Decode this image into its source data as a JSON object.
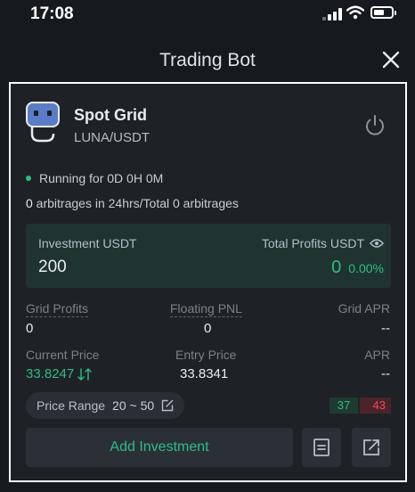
{
  "status_bar": {
    "time": "17:08"
  },
  "header": {
    "title": "Trading Bot"
  },
  "bot": {
    "name": "Spot Grid",
    "pair": "LUNA/USDT"
  },
  "status": {
    "running": "Running for 0D 0H 0M",
    "arbitrage_count": "0",
    "arbitrage_text": " arbitrages in 24hrs/Total 0 arbitrages"
  },
  "investment": {
    "label": "Investment USDT",
    "value": "200",
    "profits_label": "Total Profits USDT",
    "profits_value": "0",
    "profits_pct": "0.00%"
  },
  "stats": {
    "grid_profits_label": "Grid Profits",
    "grid_profits_value": "0",
    "floating_pnl_label": "Floating PNL",
    "floating_pnl_value": "0",
    "grid_apr_label": "Grid APR",
    "grid_apr_value": "--",
    "current_price_label": "Current Price",
    "current_price_value": "33.8247",
    "entry_price_label": "Entry Price",
    "entry_price_value": "33.8341",
    "apr_label": "APR",
    "apr_value": "--"
  },
  "price_range": {
    "label": "Price Range",
    "value": "20 ~ 50"
  },
  "order_counts": {
    "buy": "37",
    "sell": "43"
  },
  "actions": {
    "add_investment": "Add Investment"
  },
  "colors": {
    "accent_green": "#2ebd85",
    "red": "#f6465d",
    "background": "#161a1e"
  },
  "icons": [
    "signal-icon",
    "wifi-icon",
    "battery-icon",
    "close-icon",
    "bot-avatar-icon",
    "power-icon",
    "eye-icon",
    "swap-icon",
    "edit-icon",
    "details-icon",
    "share-icon"
  ]
}
